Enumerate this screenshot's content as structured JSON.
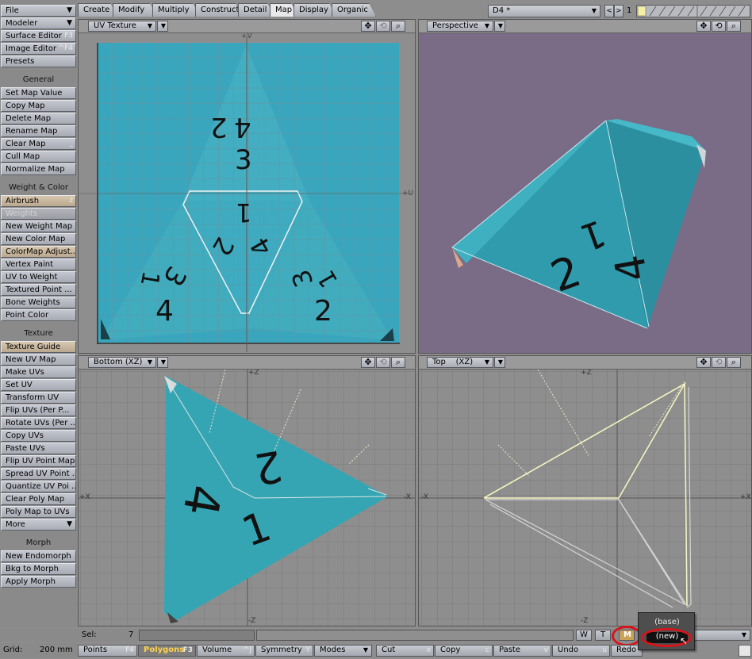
{
  "colors": {
    "uv_bg": "#3aa6bd",
    "perspective_bg": "#7a6b86",
    "grid_bg": "#8e8e8e",
    "die_face": "#35a5b4",
    "highlight_edge": "#ffffa0",
    "red_ring": "#d8141a"
  },
  "sidebar": {
    "top": [
      {
        "label": "File",
        "dropdown": true
      },
      {
        "label": "Modeler",
        "dropdown": true
      },
      {
        "label": "Surface Editor",
        "shortcut": "F3"
      },
      {
        "label": "Image Editor",
        "shortcut": "^F4"
      },
      {
        "label": "Presets",
        "shortcut": ""
      }
    ],
    "general_header": "General",
    "general": [
      {
        "label": "Set Map Value"
      },
      {
        "label": "Copy Map"
      },
      {
        "label": "Delete Map"
      },
      {
        "label": "Rename Map"
      },
      {
        "label": "Clear Map",
        "shortcut": "_"
      },
      {
        "label": "Cull Map"
      },
      {
        "label": "Normalize Map"
      }
    ],
    "weight_header": "Weight & Color",
    "weight": [
      {
        "label": "Airbrush",
        "shortcut": "z",
        "highlight": true
      },
      {
        "label": "Weights",
        "disabled": true
      },
      {
        "label": "New Weight Map"
      },
      {
        "label": "New Color Map"
      },
      {
        "label": "ColorMap Adjust...",
        "highlight": true
      },
      {
        "label": "Vertex Paint"
      },
      {
        "label": "UV to Weight"
      },
      {
        "label": "Textured Point ..."
      },
      {
        "label": "Bone Weights"
      },
      {
        "label": "Point Color"
      }
    ],
    "texture_header": "Texture",
    "texture": [
      {
        "label": "Texture Guide",
        "highlight": true
      },
      {
        "label": "New UV Map"
      },
      {
        "label": "Make UVs"
      },
      {
        "label": "Set UV"
      },
      {
        "label": "Transform UV"
      },
      {
        "label": "Flip UVs (Per P..."
      },
      {
        "label": "Rotate UVs (Per ..."
      },
      {
        "label": "Copy UVs"
      },
      {
        "label": "Paste UVs"
      },
      {
        "label": "Flip UV Point Map"
      },
      {
        "label": "Spread UV Point ..."
      },
      {
        "label": "Quantize UV Poi ..."
      },
      {
        "label": "Clear Poly Map"
      },
      {
        "label": "Poly Map to UVs"
      },
      {
        "label": "More",
        "dropdown": true
      }
    ],
    "morph_header": "Morph",
    "morph": [
      {
        "label": "New Endomorph"
      },
      {
        "label": "Bkg to Morph"
      },
      {
        "label": "Apply Morph"
      }
    ]
  },
  "tabs": [
    {
      "label": "Create"
    },
    {
      "label": "Modify"
    },
    {
      "label": "Multiply"
    },
    {
      "label": "Construct"
    },
    {
      "label": "Detail"
    },
    {
      "label": "Map",
      "active": true
    },
    {
      "label": "Display"
    },
    {
      "label": "Organic"
    }
  ],
  "toolbar": {
    "object_name": "D4 *",
    "layer_number": "1"
  },
  "viewports": {
    "uv": {
      "title": "UV Texture",
      "axis_v": "+V",
      "axis_u": "+U"
    },
    "perspective": {
      "title": "Perspective"
    },
    "bottom": {
      "title": "Bottom",
      "axes": "(XZ)",
      "axis_pz": "+Z",
      "axis_nz": "-Z",
      "axis_nx": "+X",
      "axis_px": "-X"
    },
    "top": {
      "title": "Top",
      "axes": "(XZ)",
      "axis_pz": "+Z",
      "axis_nz": "-Z",
      "axis_nx": "-X",
      "axis_px": "+X"
    }
  },
  "uv_labels": {
    "top_face": [
      "2",
      "4",
      "3"
    ],
    "center_face": [
      "1",
      "2",
      "4"
    ],
    "left_face": [
      "1",
      "3",
      "4"
    ],
    "right_face": [
      "3",
      "1",
      "2"
    ]
  },
  "perspective_labels": [
    "1",
    "2",
    "4"
  ],
  "bottom_labels": [
    "2",
    "4",
    "1"
  ],
  "status": {
    "sel_label": "Sel:",
    "sel_value": "7",
    "grid_label": "Grid:",
    "grid_value": "200 mm",
    "wtm": [
      "W",
      "T",
      "M"
    ]
  },
  "popup": {
    "items": [
      "(base)",
      "(new)"
    ]
  },
  "bottom_bar": [
    {
      "label": "Points",
      "shortcut": "F4"
    },
    {
      "label": "Polygons",
      "shortcut": "F3",
      "selected": true
    },
    {
      "label": "Volume",
      "shortcut": "^J"
    },
    {
      "label": "Symmetry",
      "shortcut": "Y"
    },
    {
      "label": "Modes",
      "dropdown": true
    },
    {
      "label": "Cut",
      "shortcut": "x"
    },
    {
      "label": "Copy",
      "shortcut": "c"
    },
    {
      "label": "Paste",
      "shortcut": "v"
    },
    {
      "label": "Undo",
      "shortcut": "u"
    },
    {
      "label": "Redo",
      "shortcut": ""
    }
  ]
}
